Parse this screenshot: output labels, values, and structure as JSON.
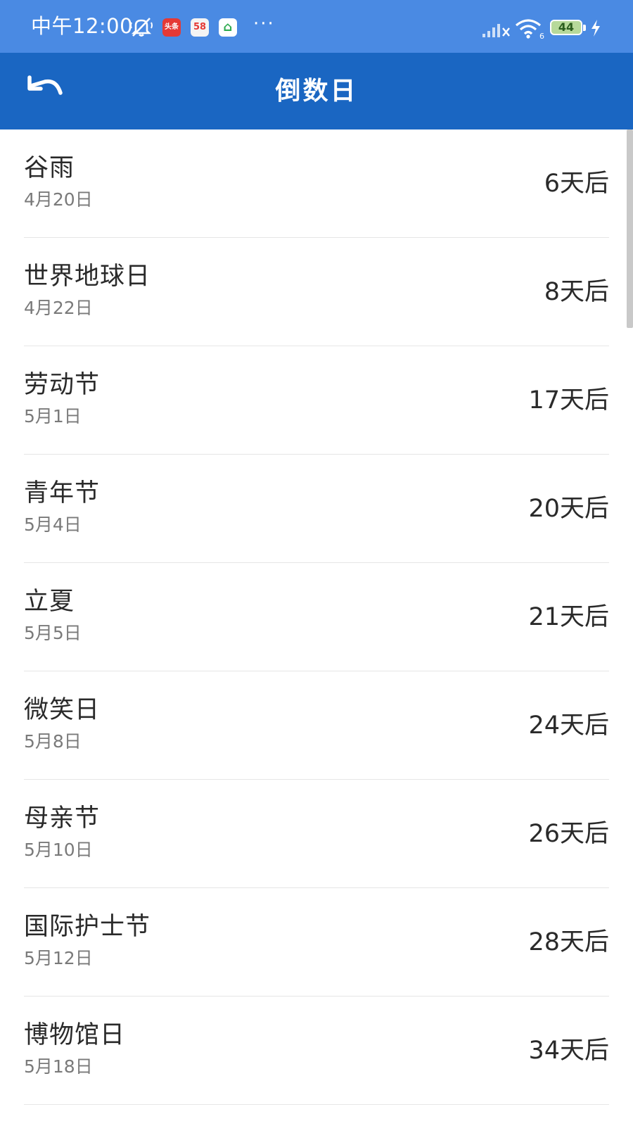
{
  "status_bar": {
    "time": "中午12:00",
    "battery": "44",
    "more": "···",
    "app_icons": [
      {
        "name": "toutiao-app-icon",
        "label": "头条",
        "color": "#e53935"
      },
      {
        "name": "58-app-icon",
        "label": "58",
        "color": "#f4f4f4"
      },
      {
        "name": "vcapro-app-icon",
        "label": "⌂",
        "color": "#2eab50"
      }
    ]
  },
  "header": {
    "title": "倒数日",
    "background": "#1a66c2"
  },
  "events": [
    {
      "name": "谷雨",
      "date": "4月20日",
      "countdown": "6天后"
    },
    {
      "name": "世界地球日",
      "date": "4月22日",
      "countdown": "8天后"
    },
    {
      "name": "劳动节",
      "date": "5月1日",
      "countdown": "17天后"
    },
    {
      "name": "青年节",
      "date": "5月4日",
      "countdown": "20天后"
    },
    {
      "name": "立夏",
      "date": "5月5日",
      "countdown": "21天后"
    },
    {
      "name": "微笑日",
      "date": "5月8日",
      "countdown": "24天后"
    },
    {
      "name": "母亲节",
      "date": "5月10日",
      "countdown": "26天后"
    },
    {
      "name": "国际护士节",
      "date": "5月12日",
      "countdown": "28天后"
    },
    {
      "name": "博物馆日",
      "date": "5月18日",
      "countdown": "34天后"
    }
  ]
}
